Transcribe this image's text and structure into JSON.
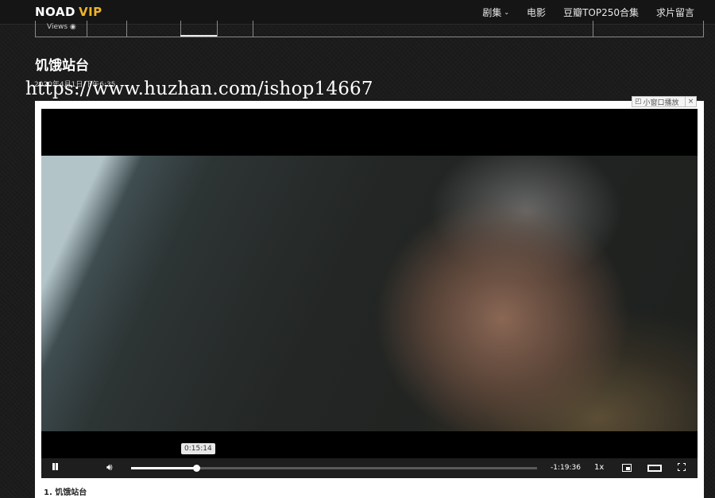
{
  "header": {
    "logo_brand": "NOAD",
    "logo_vip": "VIP",
    "nav": [
      {
        "label": "剧集",
        "has_dropdown": true
      },
      {
        "label": "电影"
      },
      {
        "label": "豆瓣TOP250合集"
      },
      {
        "label": "求片留言"
      }
    ]
  },
  "tabs": {
    "views_label": "Views"
  },
  "post": {
    "title": "饥饿站台",
    "date": "2020年4月1日 下午6:35"
  },
  "watermark": "https://www.huzhan.com/ishop14667",
  "mini_window": {
    "label": "小窗口播放",
    "close": "×"
  },
  "player": {
    "current_time_tip": "0:15:14",
    "time_remaining": "-1:19:36",
    "speed": "1x",
    "progress_fraction": 0.16
  },
  "playlist": {
    "first_item": "1. 饥饿站台"
  },
  "colors": {
    "vip_accent": "#f0b429",
    "page_bg": "#1b1b1b"
  }
}
